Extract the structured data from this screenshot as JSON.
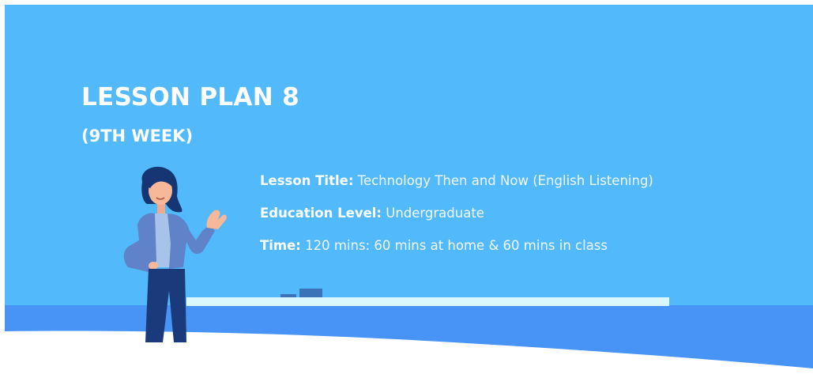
{
  "slide": {
    "title": "LESSON PLAN 8",
    "subtitle": "(9TH WEEK)",
    "details": [
      {
        "label": "Lesson Title:",
        "value": " Technology Then and Now (English Listening)"
      },
      {
        "label": "Education Level:",
        "value": " Undergraduate"
      },
      {
        "label": "Time:",
        "value": " 120 mins: 60 mins at home & 60 mins in class"
      }
    ]
  },
  "colors": {
    "sky": "#52b9fb",
    "ground": "#4794f6",
    "board": "#d9f7fd",
    "text": "#ffffff"
  },
  "icons": {
    "illustration": "teacher-presenting-illustration"
  }
}
